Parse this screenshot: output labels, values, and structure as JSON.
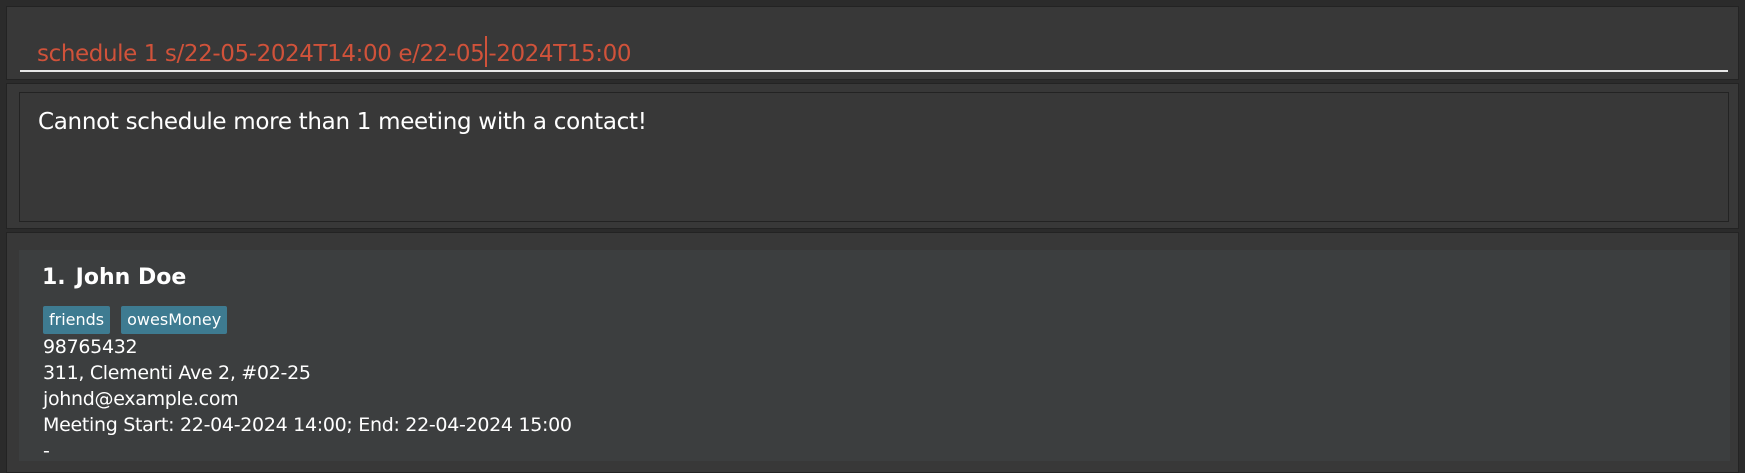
{
  "command_box": {
    "before_cursor": "schedule 1 s/22-05-2024T14:00 e/22-05",
    "after_cursor": "-2024T15:00"
  },
  "result_display": {
    "text": "Cannot schedule more than 1 meeting with a contact!"
  },
  "person_list": {
    "items": [
      {
        "index": "1.",
        "name": "John Doe",
        "tags": [
          "friends",
          "owesMoney"
        ],
        "phone": "98765432",
        "address": "311, Clementi Ave 2, #02-25",
        "email": "johnd@example.com",
        "meeting": "Meeting Start: 22-04-2024 14:00; End: 22-04-2024 15:00",
        "remark": "-"
      }
    ]
  },
  "colors": {
    "background": "#2b2b2b",
    "panel": "#383838",
    "card": "#3c3e3f",
    "command_text_error": "#d0523a",
    "tag": "#3e7b91"
  }
}
